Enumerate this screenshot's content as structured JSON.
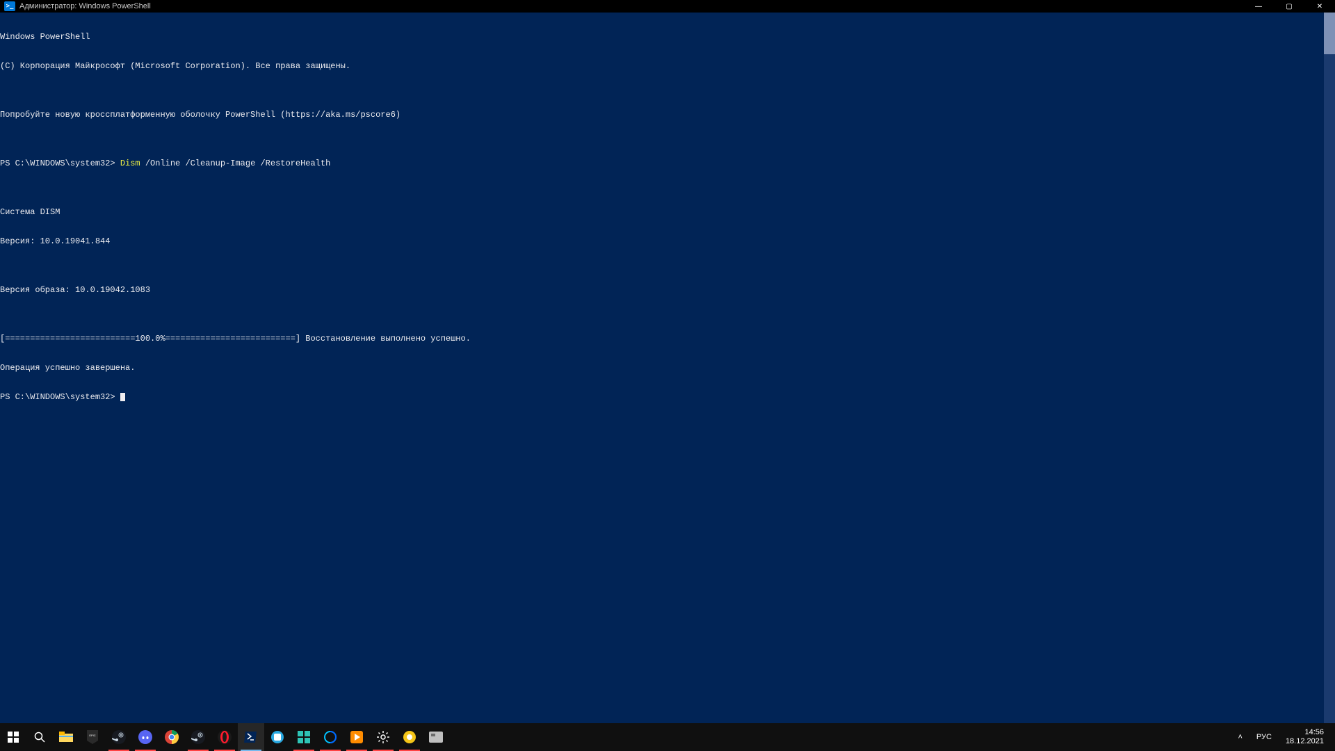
{
  "titlebar": {
    "icon_label": ">_",
    "title": "Администратор: Windows PowerShell",
    "minimize": "—",
    "maximize": "▢",
    "close": "✕"
  },
  "console": {
    "lines": [
      "Windows PowerShell",
      "(C) Корпорация Майкрософт (Microsoft Corporation). Все права защищены.",
      "",
      "Попробуйте новую кроссплатформенную оболочку PowerShell (https://aka.ms/pscore6)",
      "",
      "",
      "",
      "Система DISM",
      "Версия: 10.0.19041.844",
      "",
      "Версия образа: 10.0.19042.1083",
      "",
      "[==========================100.0%==========================] Восстановление выполнено успешно.",
      "Операция успешно завершена.",
      "PS C:\\WINDOWS\\system32>"
    ],
    "prompt_line": {
      "prompt": "PS C:\\WINDOWS\\system32> ",
      "cmd": "Dism",
      "args": " /Online /Cleanup-Image /RestoreHealth"
    }
  },
  "taskbar": {
    "items": [
      {
        "name": "start-button",
        "under": ""
      },
      {
        "name": "search-button",
        "under": ""
      },
      {
        "name": "file-explorer",
        "under": ""
      },
      {
        "name": "epic-games",
        "under": ""
      },
      {
        "name": "steam",
        "under": "red"
      },
      {
        "name": "discord",
        "under": "red"
      },
      {
        "name": "chrome",
        "under": ""
      },
      {
        "name": "steam-2",
        "under": "red"
      },
      {
        "name": "opera",
        "under": "red"
      },
      {
        "name": "powershell",
        "under": "blue",
        "active": true
      },
      {
        "name": "app-blue-1",
        "under": ""
      },
      {
        "name": "app-teal",
        "under": "red"
      },
      {
        "name": "app-c",
        "under": "red"
      },
      {
        "name": "media-player",
        "under": "red"
      },
      {
        "name": "settings",
        "under": "red"
      },
      {
        "name": "app-orange",
        "under": "red"
      },
      {
        "name": "app-gray",
        "under": ""
      }
    ],
    "systray": {
      "chevron": "˄",
      "lang": "РУС",
      "time": "14:56",
      "date": "18.12.2021"
    }
  },
  "colors": {
    "ps_bg": "#012456",
    "ps_yellow": "#f5f543",
    "taskbar_bg": "#101010"
  }
}
